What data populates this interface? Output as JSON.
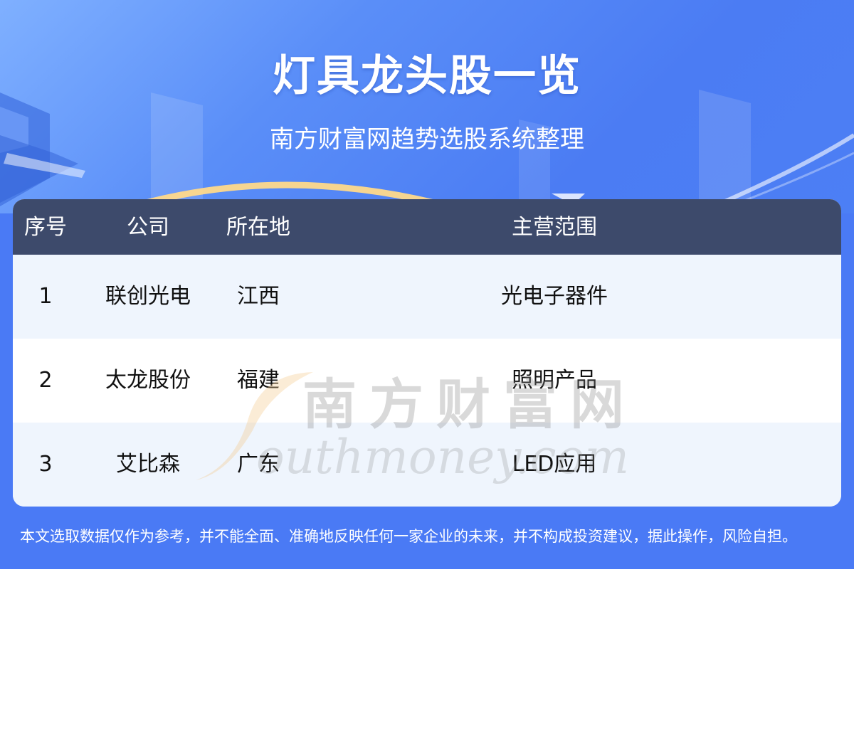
{
  "header": {
    "title": "灯具龙头股一览",
    "subtitle": "南方财富网趋势选股系统整理"
  },
  "table": {
    "columns": [
      "序号",
      "公司",
      "所在地",
      "主营范围"
    ],
    "rows": [
      {
        "index": "1",
        "company": "联创光电",
        "location": "江西",
        "business": "光电子器件"
      },
      {
        "index": "2",
        "company": "太龙股份",
        "location": "福建",
        "business": "照明产品"
      },
      {
        "index": "3",
        "company": "艾比森",
        "location": "广东",
        "business": "LED应用"
      }
    ]
  },
  "watermark": {
    "cn": "南方财富网",
    "en": "outhmoney.com"
  },
  "footer": {
    "disclaimer": "本文选取数据仅作为参考，并不能全面、准确地反映任何一家企业的未来，并不构成投资建议，据此操作，风险自担。"
  },
  "colors": {
    "background": "#4a7af5",
    "table_header": "#3d4a6b",
    "row_alt": "#eff5fd",
    "text_white": "#ffffff"
  }
}
